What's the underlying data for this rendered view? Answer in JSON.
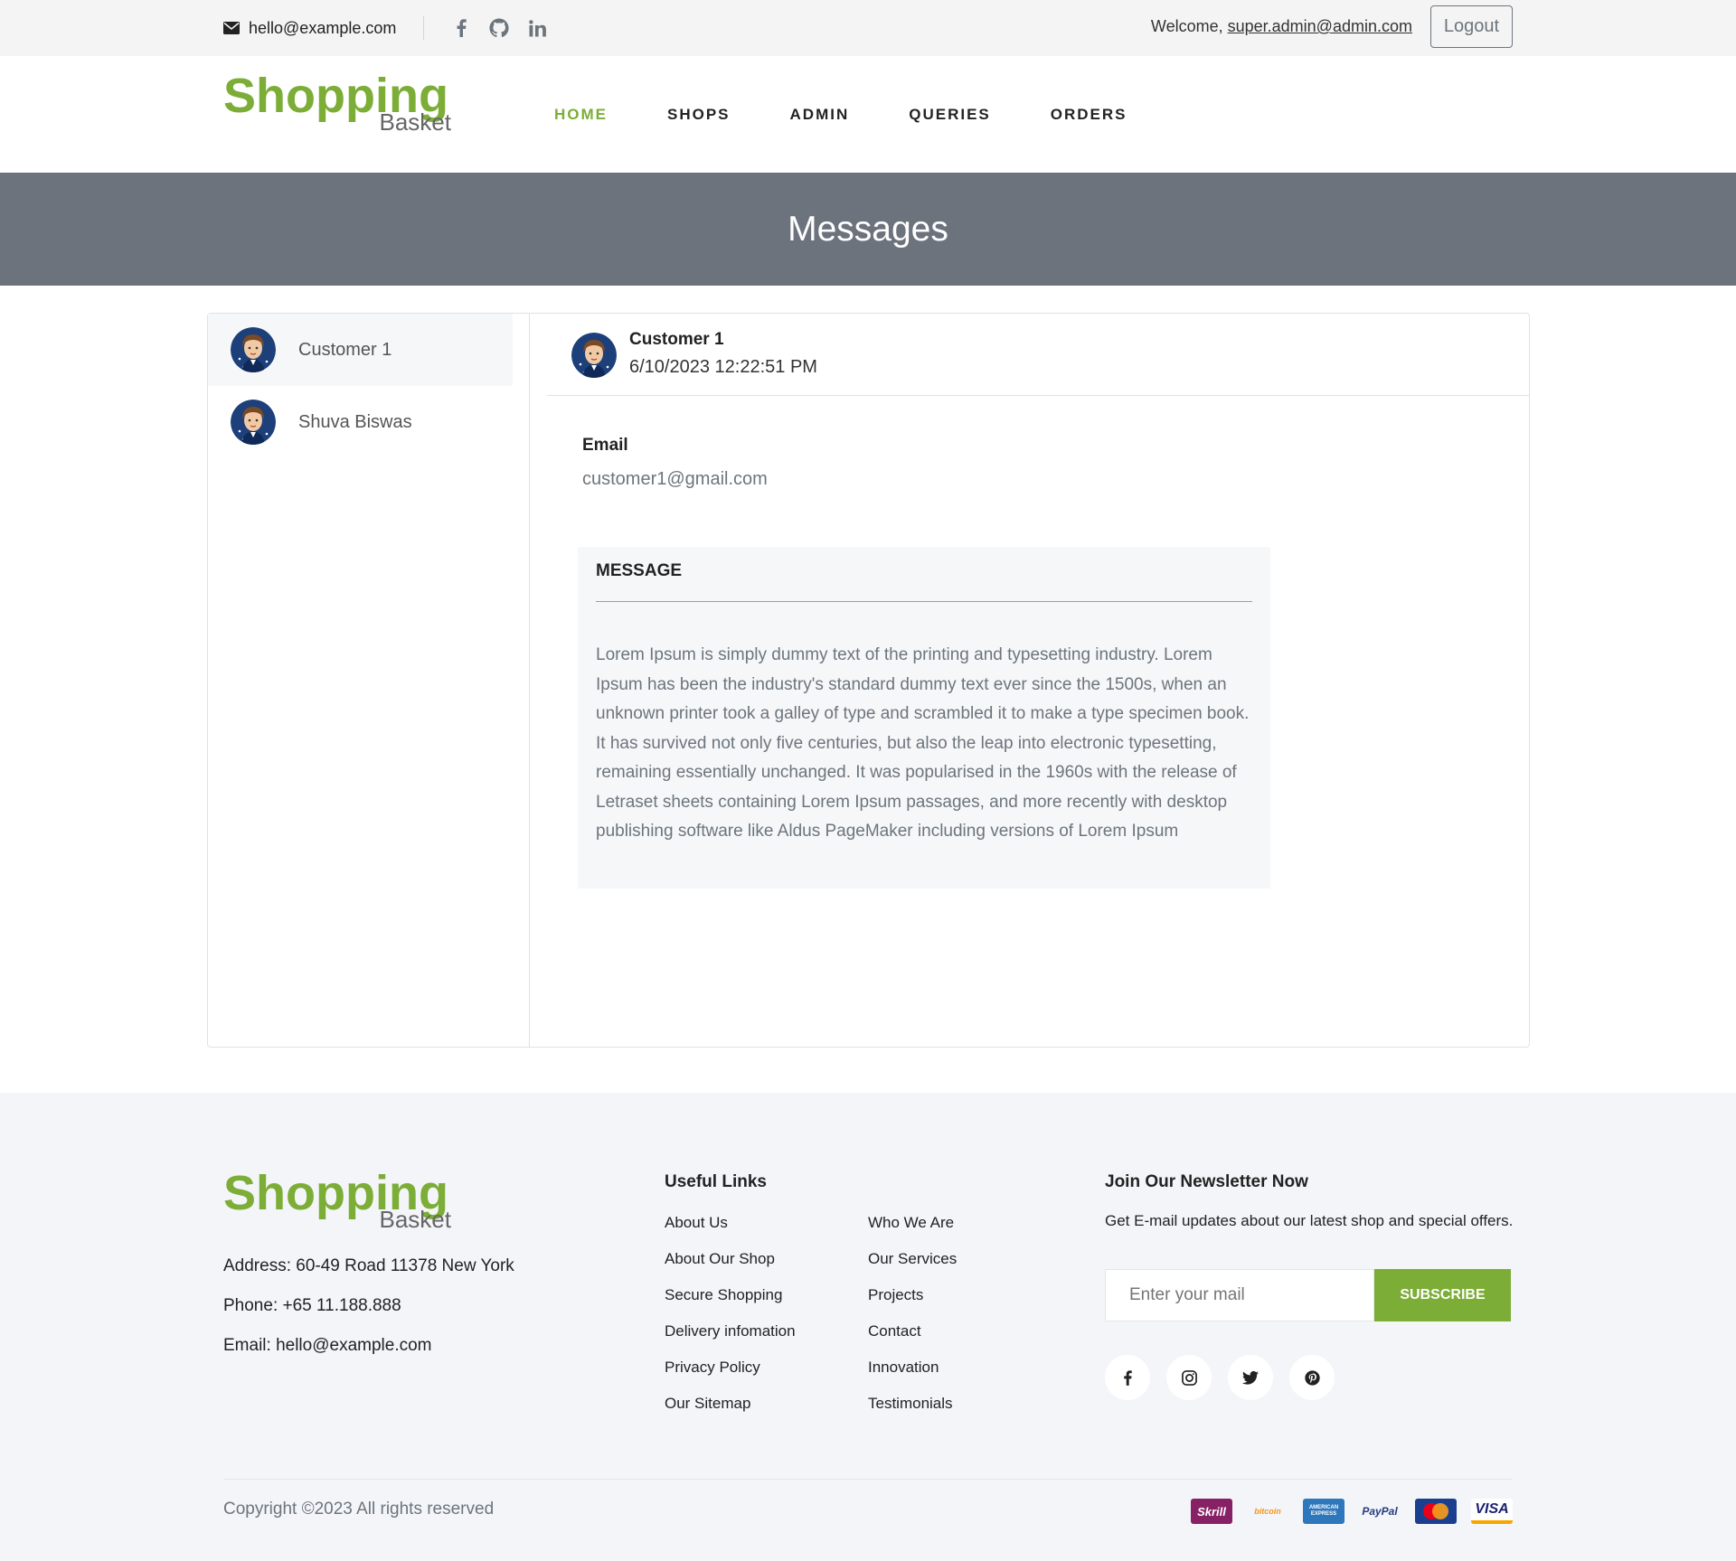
{
  "topbar": {
    "email": "hello@example.com",
    "welcome_prefix": "Welcome, ",
    "user_email": "super.admin@admin.com",
    "logout_label": "Logout",
    "social_icons": [
      "facebook-icon",
      "github-icon",
      "linkedin-icon"
    ]
  },
  "brand": {
    "name_top": "Shopping",
    "name_bottom": "Basket",
    "accent": "#7cad36"
  },
  "nav": {
    "items": [
      {
        "label": "HOME",
        "active": true
      },
      {
        "label": "SHOPS"
      },
      {
        "label": "ADMIN"
      },
      {
        "label": "QUERIES"
      },
      {
        "label": "ORDERS"
      }
    ]
  },
  "hero": {
    "title": "Messages",
    "bg": "#6c737d"
  },
  "contacts": [
    {
      "name": "Customer 1",
      "selected": true
    },
    {
      "name": "Shuva Biswas",
      "selected": false
    }
  ],
  "conversation": {
    "name": "Customer 1",
    "datetime": "6/10/2023 12:22:51 PM",
    "email_label": "Email",
    "email_value": "customer1@gmail.com",
    "message_heading": "MESSAGE",
    "message_body": "Lorem Ipsum is simply dummy text of the printing and typesetting industry. Lorem Ipsum has been the industry's standard dummy text ever since the 1500s, when an unknown printer took a galley of type and scrambled it to make a type specimen book. It has survived not only five centuries, but also the leap into electronic typesetting, remaining essentially unchanged. It was popularised in the 1960s with the release of Letraset sheets containing Lorem Ipsum passages, and more recently with desktop publishing software like Aldus PageMaker including versions of Lorem Ipsum"
  },
  "footer": {
    "address": "Address: 60-49 Road 11378 New York",
    "phone": "Phone: +65 11.188.888",
    "email": "Email: hello@example.com",
    "useful_links_title": "Useful Links",
    "links_col1": [
      "About Us",
      "About Our Shop",
      "Secure Shopping",
      "Delivery infomation",
      "Privacy Policy",
      "Our Sitemap"
    ],
    "links_col2": [
      "Who We Are",
      "Our Services",
      "Projects",
      "Contact",
      "Innovation",
      "Testimonials"
    ],
    "newsletter_title": "Join Our Newsletter Now",
    "newsletter_text": "Get E-mail updates about our latest shop and special offers.",
    "newsletter_placeholder": "Enter your mail",
    "subscribe_label": "SUBSCRIBE",
    "social_icons": [
      "facebook-icon",
      "instagram-icon",
      "twitter-icon",
      "pinterest-icon"
    ],
    "copyright": "Copyright ©2023 All rights reserved",
    "payments": [
      {
        "name": "Skrill",
        "color": "#862165"
      },
      {
        "name": "bitcoin",
        "color": "#f7931a"
      },
      {
        "name": "AMERICAN EXPRESS",
        "color": "#2e77bc"
      },
      {
        "name": "PayPal",
        "color": "#253b80"
      },
      {
        "name": "MasterCard",
        "color": "#eb001b"
      },
      {
        "name": "VISA",
        "color": "#1a1f71"
      }
    ]
  }
}
